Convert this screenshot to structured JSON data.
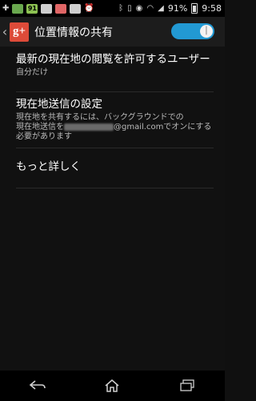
{
  "status_bar": {
    "battery_percent": "91%",
    "time": "9:58"
  },
  "header": {
    "logo_text": "g+",
    "title": "位置情報の共有",
    "toggle_on": true
  },
  "items": [
    {
      "title": "最新の現在地の閲覧を許可するユーザー",
      "summary": "自分だけ"
    },
    {
      "title": "現在地送信の設定",
      "summary_line1": "現在地を共有するには、バックグラウンドでの",
      "summary_line2_prefix": "現在地送信を",
      "summary_line2_suffix": "@gmail.comでオンにする",
      "summary_line3": "必要があります"
    },
    {
      "title": "もっと詳しく"
    }
  ],
  "nav": {
    "back": "back-icon",
    "home": "home-icon",
    "recents": "recents-icon"
  }
}
